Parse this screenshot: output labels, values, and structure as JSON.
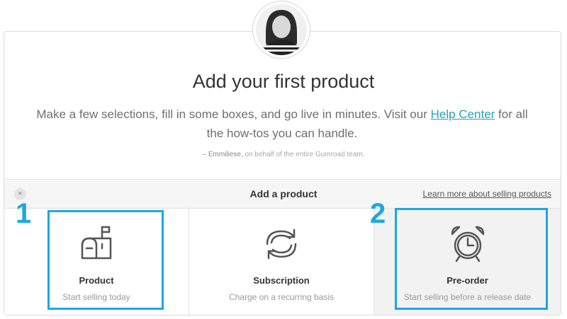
{
  "intro": {
    "headline": "Add your first product",
    "line_before_link": "Make a few selections, fill in some boxes, and go live in minutes. Visit our ",
    "help_link": "Help Center",
    "line_after_link": " for all the how-tos you can handle.",
    "author": "– Emmiliese,",
    "signature_rest": " on behalf of the entire Gumroad team."
  },
  "panel": {
    "close_icon": "×",
    "title": "Add a product",
    "learn_more": "Learn more about selling products"
  },
  "options": [
    {
      "icon": "mailbox-icon",
      "name": "Product",
      "desc": "Start selling today"
    },
    {
      "icon": "refresh-icon",
      "name": "Subscription",
      "desc": "Charge on a recurring basis"
    },
    {
      "icon": "alarm-clock-icon",
      "name": "Pre-order",
      "desc": "Start selling before a release date"
    }
  ],
  "annotations": {
    "label_1": "1",
    "label_2": "2",
    "color": "#1ea7e0"
  },
  "colors": {
    "link": "#2a9fb8",
    "selected_option_bg": "#f2f2f2"
  }
}
